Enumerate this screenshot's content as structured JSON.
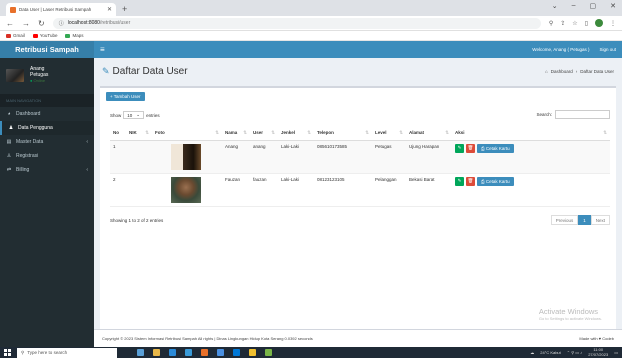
{
  "browser": {
    "tab_title": "Data User | Laser Retribusi Sampah",
    "url_domain": "localhost:8080",
    "url_path": "/retribusi/user",
    "bookmarks": [
      {
        "label": "Gmail",
        "color": "#d93025"
      },
      {
        "label": "YouTube",
        "color": "#ff0000"
      },
      {
        "label": "Maps",
        "color": "#34a853"
      }
    ]
  },
  "header": {
    "app_name": "Retribusi Sampah",
    "welcome": "Welcome, Anang ( Petugas )",
    "signout": "Sign out"
  },
  "sidebar": {
    "user_name": "Anang",
    "user_role": "Petugas",
    "user_status": "Online",
    "nav_header": "MAIN NAVIGATION",
    "items": [
      {
        "label": "Dashboard",
        "icon": "dashboard-icon",
        "active": false
      },
      {
        "label": "Data Pengguna",
        "icon": "user-icon",
        "active": true
      },
      {
        "label": "Master Data",
        "icon": "list-icon",
        "active": false
      },
      {
        "label": "Registrasi",
        "icon": "user-add-icon",
        "active": false
      },
      {
        "label": "Billing",
        "icon": "billing-icon",
        "active": false
      }
    ]
  },
  "page": {
    "title": "Daftar Data User",
    "breadcrumb": [
      "Dashboard",
      "Daftar Data User"
    ],
    "add_button": "+ Tambah User",
    "show_label": "Show",
    "entries_value": "10",
    "entries_label": "entries",
    "search_label": "Search:",
    "columns": [
      "No",
      "NIK",
      "Foto",
      "Nama",
      "User",
      "Jenkel",
      "Telepon",
      "Level",
      "Alamat",
      "Aksi"
    ],
    "rows": [
      {
        "no": "1",
        "nik": "",
        "nama": "Anang",
        "user": "anang",
        "jenkel": "Laki-Laki",
        "telepon": "085610173585",
        "level": "Petugas",
        "alamat": "Ujung Harapan"
      },
      {
        "no": "2",
        "nik": "",
        "nama": "Fauzan",
        "user": "fauzan",
        "jenkel": "Laki-Laki",
        "telepon": "08123123105",
        "level": "Pelanggan",
        "alamat": "Bekasi Barat"
      }
    ],
    "print_label": "Cetak Kartu",
    "info": "Showing 1 to 2 of 2 entries",
    "pager": {
      "prev": "Previous",
      "current": "1",
      "next": "Next"
    }
  },
  "watermark": {
    "line1": "Activate Windows",
    "line2": "Go to Settings to activate Windows."
  },
  "footer": {
    "copyright": "Copyright © 2023 Sistem Informasi Retribusi Sampah All rights | Dinas Lingkungan Hidup Kota Serang 0.0392 seconds",
    "made": "Made with ♥ Codeb"
  },
  "taskbar": {
    "search_placeholder": "Type here to search",
    "weather": "24°C Kabut",
    "time": "11:00",
    "date": "27/07/2023"
  }
}
